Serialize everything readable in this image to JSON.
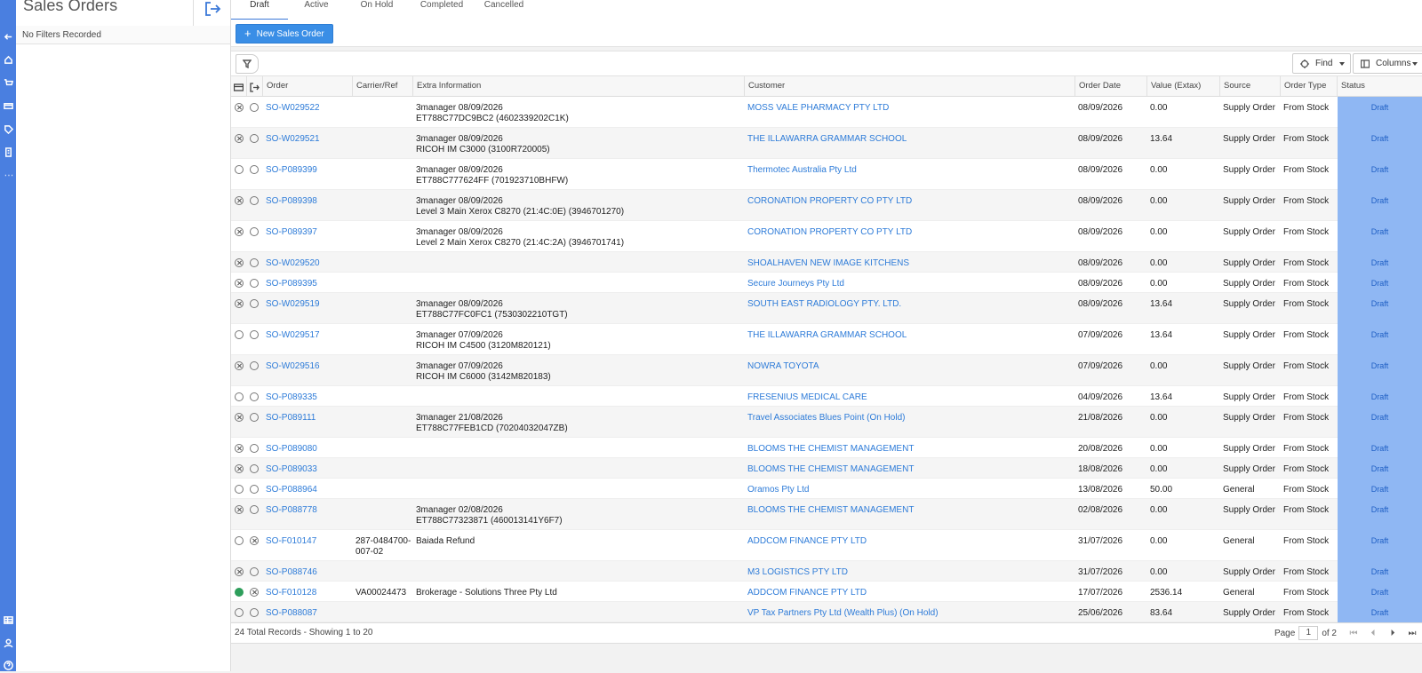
{
  "side_panel": {
    "title": "Sales Orders",
    "filter_text": "No Filters Recorded"
  },
  "tabs": [
    {
      "label": "Draft",
      "active": true
    },
    {
      "label": "Active",
      "active": false
    },
    {
      "label": "On Hold",
      "active": false
    },
    {
      "label": "Completed",
      "active": false
    },
    {
      "label": "Cancelled",
      "active": false
    }
  ],
  "toolbar": {
    "new_label": "New Sales Order",
    "find_label": "Find",
    "columns_label": "Columns"
  },
  "columns": [
    "Order",
    "Carrier/Ref",
    "Extra Information",
    "Customer",
    "Order Date",
    "Value (Extax)",
    "Source",
    "Order Type",
    "Status"
  ],
  "rows": [
    {
      "c1": "x",
      "c2": "o",
      "order": "SO-W029522",
      "carrier": "",
      "extra": [
        "3manager 08/09/2026",
        "ET788C77DC9BC2 (4602339202C1K)"
      ],
      "customer": "MOSS VALE PHARMACY PTY LTD",
      "date": "08/09/2026",
      "value": "0.00",
      "source": "Supply Order",
      "type": "From Stock",
      "status": "Draft"
    },
    {
      "c1": "x",
      "c2": "o",
      "order": "SO-W029521",
      "carrier": "",
      "extra": [
        "3manager 08/09/2026",
        "RICOH IM C3000 (3100R720005)"
      ],
      "customer": "THE ILLAWARRA GRAMMAR SCHOOL",
      "date": "08/09/2026",
      "value": "13.64",
      "source": "Supply Order",
      "type": "From Stock",
      "status": "Draft"
    },
    {
      "c1": "o",
      "c2": "o",
      "order": "SO-P089399",
      "carrier": "",
      "extra": [
        "3manager 08/09/2026",
        "ET788C777624FF (701923710BHFW)"
      ],
      "customer": "Thermotec Australia Pty Ltd",
      "date": "08/09/2026",
      "value": "0.00",
      "source": "Supply Order",
      "type": "From Stock",
      "status": "Draft"
    },
    {
      "c1": "x",
      "c2": "o",
      "order": "SO-P089398",
      "carrier": "",
      "extra": [
        "3manager 08/09/2026",
        "Level 3 Main Xerox C8270 (21:4C:0E) (3946701270)"
      ],
      "customer": "CORONATION PROPERTY CO PTY LTD",
      "date": "08/09/2026",
      "value": "0.00",
      "source": "Supply Order",
      "type": "From Stock",
      "status": "Draft"
    },
    {
      "c1": "x",
      "c2": "o",
      "order": "SO-P089397",
      "carrier": "",
      "extra": [
        "3manager 08/09/2026",
        "Level 2 Main Xerox C8270 (21:4C:2A) (3946701741)"
      ],
      "customer": "CORONATION PROPERTY CO PTY LTD",
      "date": "08/09/2026",
      "value": "0.00",
      "source": "Supply Order",
      "type": "From Stock",
      "status": "Draft"
    },
    {
      "c1": "x",
      "c2": "o",
      "order": "SO-W029520",
      "carrier": "",
      "extra": [],
      "customer": "SHOALHAVEN NEW IMAGE KITCHENS",
      "date": "08/09/2026",
      "value": "0.00",
      "source": "Supply Order",
      "type": "From Stock",
      "status": "Draft"
    },
    {
      "c1": "x",
      "c2": "o",
      "order": "SO-P089395",
      "carrier": "",
      "extra": [],
      "customer": "Secure Journeys Pty Ltd",
      "date": "08/09/2026",
      "value": "0.00",
      "source": "Supply Order",
      "type": "From Stock",
      "status": "Draft"
    },
    {
      "c1": "x",
      "c2": "o",
      "order": "SO-W029519",
      "carrier": "",
      "extra": [
        "3manager 08/09/2026",
        "ET788C77FC0FC1 (7530302210TGT)"
      ],
      "customer": "SOUTH EAST RADIOLOGY PTY. LTD.",
      "date": "08/09/2026",
      "value": "13.64",
      "source": "Supply Order",
      "type": "From Stock",
      "status": "Draft"
    },
    {
      "c1": "o",
      "c2": "o",
      "order": "SO-W029517",
      "carrier": "",
      "extra": [
        "3manager 07/09/2026",
        "RICOH IM C4500 (3120M820121)"
      ],
      "customer": "THE ILLAWARRA GRAMMAR SCHOOL",
      "date": "07/09/2026",
      "value": "13.64",
      "source": "Supply Order",
      "type": "From Stock",
      "status": "Draft"
    },
    {
      "c1": "x",
      "c2": "o",
      "order": "SO-W029516",
      "carrier": "",
      "extra": [
        "3manager 07/09/2026",
        "RICOH IM C6000 (3142M820183)"
      ],
      "customer": "NOWRA TOYOTA",
      "date": "07/09/2026",
      "value": "0.00",
      "source": "Supply Order",
      "type": "From Stock",
      "status": "Draft"
    },
    {
      "c1": "o",
      "c2": "o",
      "order": "SO-P089335",
      "carrier": "",
      "extra": [],
      "customer": "FRESENIUS MEDICAL CARE",
      "date": "04/09/2026",
      "value": "13.64",
      "source": "Supply Order",
      "type": "From Stock",
      "status": "Draft"
    },
    {
      "c1": "x",
      "c2": "o",
      "order": "SO-P089111",
      "carrier": "",
      "extra": [
        "3manager 21/08/2026",
        "ET788C77FEB1CD (70204032047ZB)"
      ],
      "customer": "Travel Associates Blues Point (On Hold)",
      "date": "21/08/2026",
      "value": "0.00",
      "source": "Supply Order",
      "type": "From Stock",
      "status": "Draft"
    },
    {
      "c1": "x",
      "c2": "o",
      "order": "SO-P089080",
      "carrier": "",
      "extra": [],
      "customer": "BLOOMS THE CHEMIST MANAGEMENT",
      "date": "20/08/2026",
      "value": "0.00",
      "source": "Supply Order",
      "type": "From Stock",
      "status": "Draft"
    },
    {
      "c1": "x",
      "c2": "o",
      "order": "SO-P089033",
      "carrier": "",
      "extra": [],
      "customer": "BLOOMS THE CHEMIST MANAGEMENT",
      "date": "18/08/2026",
      "value": "0.00",
      "source": "Supply Order",
      "type": "From Stock",
      "status": "Draft"
    },
    {
      "c1": "o",
      "c2": "o",
      "order": "SO-P088964",
      "carrier": "",
      "extra": [],
      "customer": "Oramos Pty Ltd",
      "date": "13/08/2026",
      "value": "50.00",
      "source": "General",
      "type": "From Stock",
      "status": "Draft"
    },
    {
      "c1": "x",
      "c2": "o",
      "order": "SO-P088778",
      "carrier": "",
      "extra": [
        "3manager 02/08/2026",
        "ET788C77323871 (460013141Y6F7)"
      ],
      "customer": "BLOOMS THE CHEMIST MANAGEMENT",
      "date": "02/08/2026",
      "value": "0.00",
      "source": "Supply Order",
      "type": "From Stock",
      "status": "Draft"
    },
    {
      "c1": "o",
      "c2": "x",
      "order": "SO-F010147",
      "carrier": "287-0484700-\n007-02",
      "extra": [
        "Baiada Refund"
      ],
      "customer": "ADDCOM FINANCE PTY LTD",
      "date": "31/07/2026",
      "value": "0.00",
      "source": "General",
      "type": "From Stock",
      "status": "Draft"
    },
    {
      "c1": "x",
      "c2": "o",
      "order": "SO-P088746",
      "carrier": "",
      "extra": [],
      "customer": "M3 LOGISTICS PTY LTD",
      "date": "31/07/2026",
      "value": "0.00",
      "source": "Supply Order",
      "type": "From Stock",
      "status": "Draft"
    },
    {
      "c1": "g",
      "c2": "x",
      "order": "SO-F010128",
      "carrier": "VA00024473",
      "extra": [
        "Brokerage - Solutions Three Pty Ltd"
      ],
      "customer": "ADDCOM FINANCE PTY LTD",
      "date": "17/07/2026",
      "value": "2536.14",
      "source": "General",
      "type": "From Stock",
      "status": "Draft"
    },
    {
      "c1": "o",
      "c2": "o",
      "order": "SO-P088087",
      "carrier": "",
      "extra": [],
      "customer": "VP Tax Partners Pty Ltd (Wealth Plus) (On Hold)",
      "date": "25/06/2026",
      "value": "83.64",
      "source": "Supply Order",
      "type": "From Stock",
      "status": "Draft"
    }
  ],
  "footer": {
    "records": "24 Total Records - Showing 1 to 20",
    "page_label": "Page",
    "page": "1",
    "of": "of 2"
  }
}
